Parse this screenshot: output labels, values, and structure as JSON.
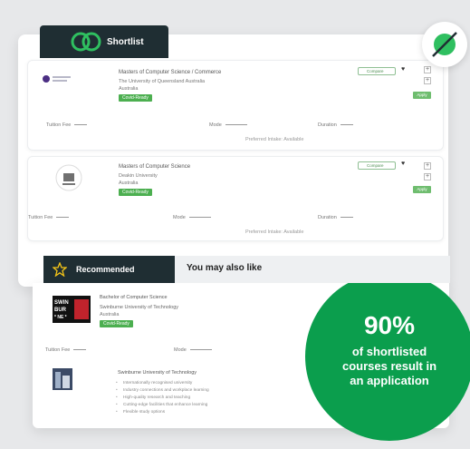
{
  "shortlist": {
    "tab_label": "Shortlist",
    "items": [
      {
        "title": "Masters of Computer Science / Commerce",
        "university": "The University of Queensland Australia",
        "country": "Australia",
        "tag": "Covid-Ready",
        "compare_label": "Compare",
        "apply_label": "Apply",
        "tuition_label": "Tuition Fee",
        "mode_label": "Mode",
        "duration_label": "Duration",
        "pref_label": "Preferred Intake: Available"
      },
      {
        "title": "Masters of Computer Science",
        "university": "Deakin University",
        "country": "Australia",
        "tag": "Covid-Ready",
        "compare_label": "Compare",
        "apply_label": "Apply",
        "tuition_label": "Tuition Fee",
        "mode_label": "Mode",
        "duration_label": "Duration",
        "pref_label": "Preferred Intake: Available"
      }
    ]
  },
  "recommended": {
    "tab_label": "Recommended",
    "also_label": "You may also like",
    "course": {
      "title": "Bachelor of Computer Science",
      "university": "Swinburne University of Technology",
      "country": "Australia",
      "tag": "Covid-Ready",
      "tuition_label": "Tuition Fee",
      "mode_label": "Mode"
    },
    "university_card": {
      "name": "Swinburne University of Technology",
      "features": [
        "Internationally recognised university",
        "Industry connections and workplace learning",
        "High-quality research and teaching",
        "Cutting-edge facilities that enhance learning",
        "Flexible study options"
      ]
    },
    "swin_logo_text": [
      "SWIN",
      "BUR",
      "* NE *"
    ]
  },
  "stat": {
    "percent": "90%",
    "text": "of shortlisted\ncourses result in\nan application"
  },
  "colors": {
    "dark": "#1f2e33",
    "green": "#0b9e4d",
    "accent_green": "#4caf50"
  }
}
